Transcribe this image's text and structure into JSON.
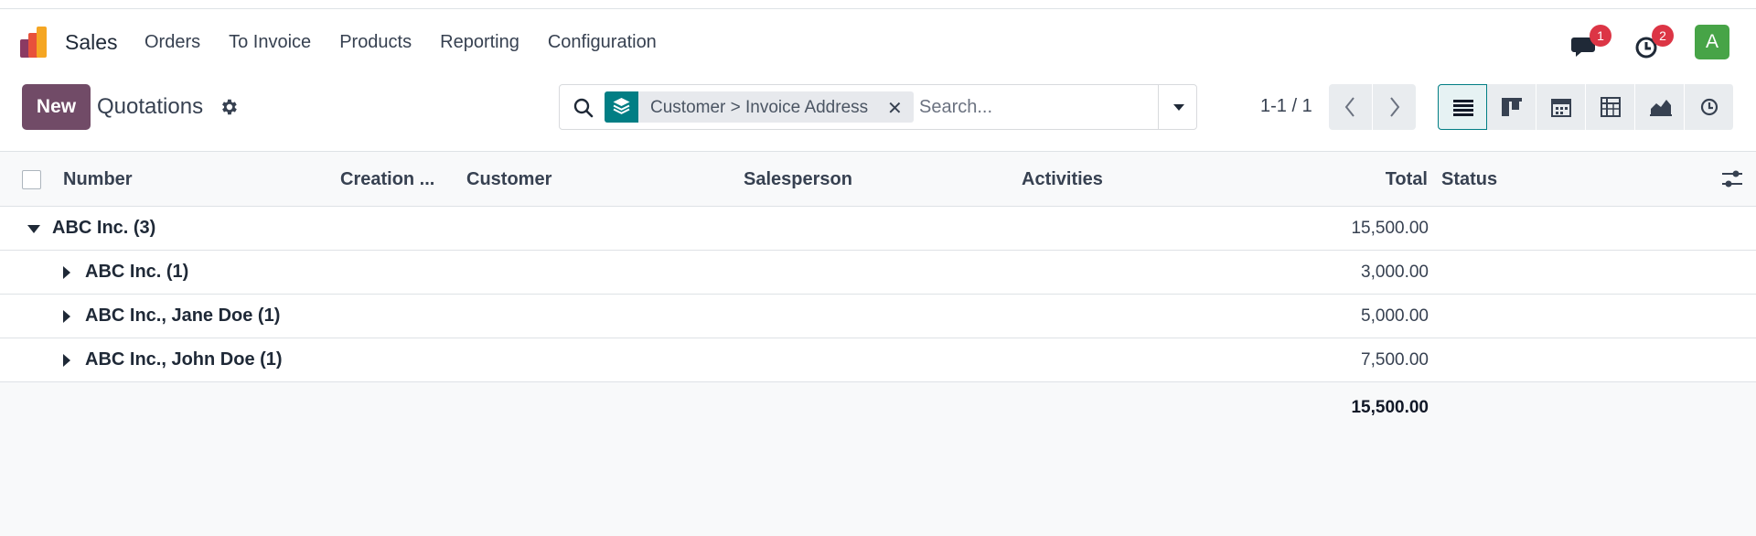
{
  "navbar": {
    "app_name": "Sales",
    "menu": [
      "Orders",
      "To Invoice",
      "Products",
      "Reporting",
      "Configuration"
    ],
    "messages_badge": "1",
    "activities_badge": "2",
    "avatar_letter": "A",
    "colors": {
      "avatar": "#47a447",
      "badge": "#dc3545"
    }
  },
  "control": {
    "new_label": "New",
    "title": "Quotations",
    "search": {
      "facet_label": "Customer > Invoice Address",
      "placeholder": "Search..."
    },
    "pager": "1-1 / 1",
    "views": [
      "list-icon",
      "kanban-icon",
      "calendar-icon",
      "pivot-icon",
      "graph-icon",
      "activity-icon"
    ],
    "colors": {
      "primary": "#714B67",
      "accent": "#017e84"
    }
  },
  "table": {
    "columns": [
      "Number",
      "Creation ...",
      "Customer",
      "Salesperson",
      "Activities",
      "Total",
      "Status"
    ],
    "groups": [
      {
        "label": "ABC Inc. (3)",
        "total": "15,500.00",
        "expanded": true
      },
      {
        "label": "ABC Inc. (1)",
        "total": "3,000.00",
        "expanded": false
      },
      {
        "label": "ABC Inc., Jane Doe (1)",
        "total": "5,000.00",
        "expanded": false
      },
      {
        "label": "ABC Inc., John Doe (1)",
        "total": "7,500.00",
        "expanded": false
      }
    ],
    "grand_total": "15,500.00"
  }
}
